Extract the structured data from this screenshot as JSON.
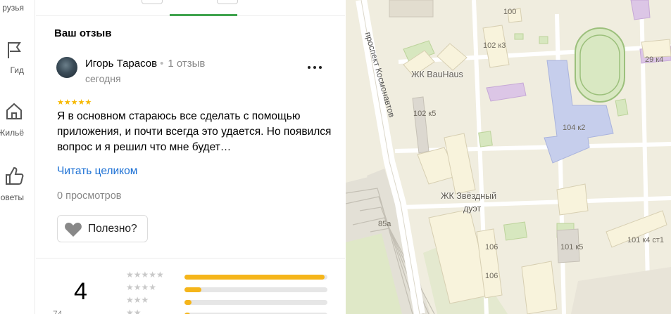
{
  "rail": {
    "items": [
      {
        "label": "рузья",
        "icon": "friends-icon"
      },
      {
        "label": "Гид",
        "icon": "flag-icon"
      },
      {
        "label": "Жильё",
        "icon": "house-icon"
      },
      {
        "label": "оветы",
        "icon": "thumbs-up-icon"
      }
    ]
  },
  "review": {
    "section_title": "Ваш отзыв",
    "author": "Игорь Тарасов",
    "author_reviews": "1 отзыв",
    "date": "сегодня",
    "stars": "★★★★★",
    "text": "Я в основном стараюсь все сделать с помощью приложения, и почти всегда это удается. Но появился вопрос и я решил что мне будет…",
    "read_more": "Читать целиком",
    "views": "0 просмотров",
    "useful": "Полезно?"
  },
  "rating": {
    "value": "4",
    "sub": "74",
    "distribution": [
      {
        "stars": "★★★★★",
        "fill": 0.98
      },
      {
        "stars": "★★★★",
        "fill": 0.12
      },
      {
        "stars": "★★★",
        "fill": 0.05
      },
      {
        "stars": "★★",
        "fill": 0.04
      }
    ]
  },
  "map": {
    "street": "проспект Космонавтов",
    "labels": [
      "100",
      "102 к3",
      "ЖК BauHaus",
      "29 к4",
      "102 к5",
      "104 к2",
      "ЖК Звёздный",
      "дуэт",
      "85а",
      "106",
      "101 к5",
      "101 к4 ст1",
      "106"
    ],
    "colors": {
      "background": "#f0eddf",
      "accent_green": "#3fa34d",
      "star": "#f6b800",
      "link": "#1a6fd4"
    }
  }
}
